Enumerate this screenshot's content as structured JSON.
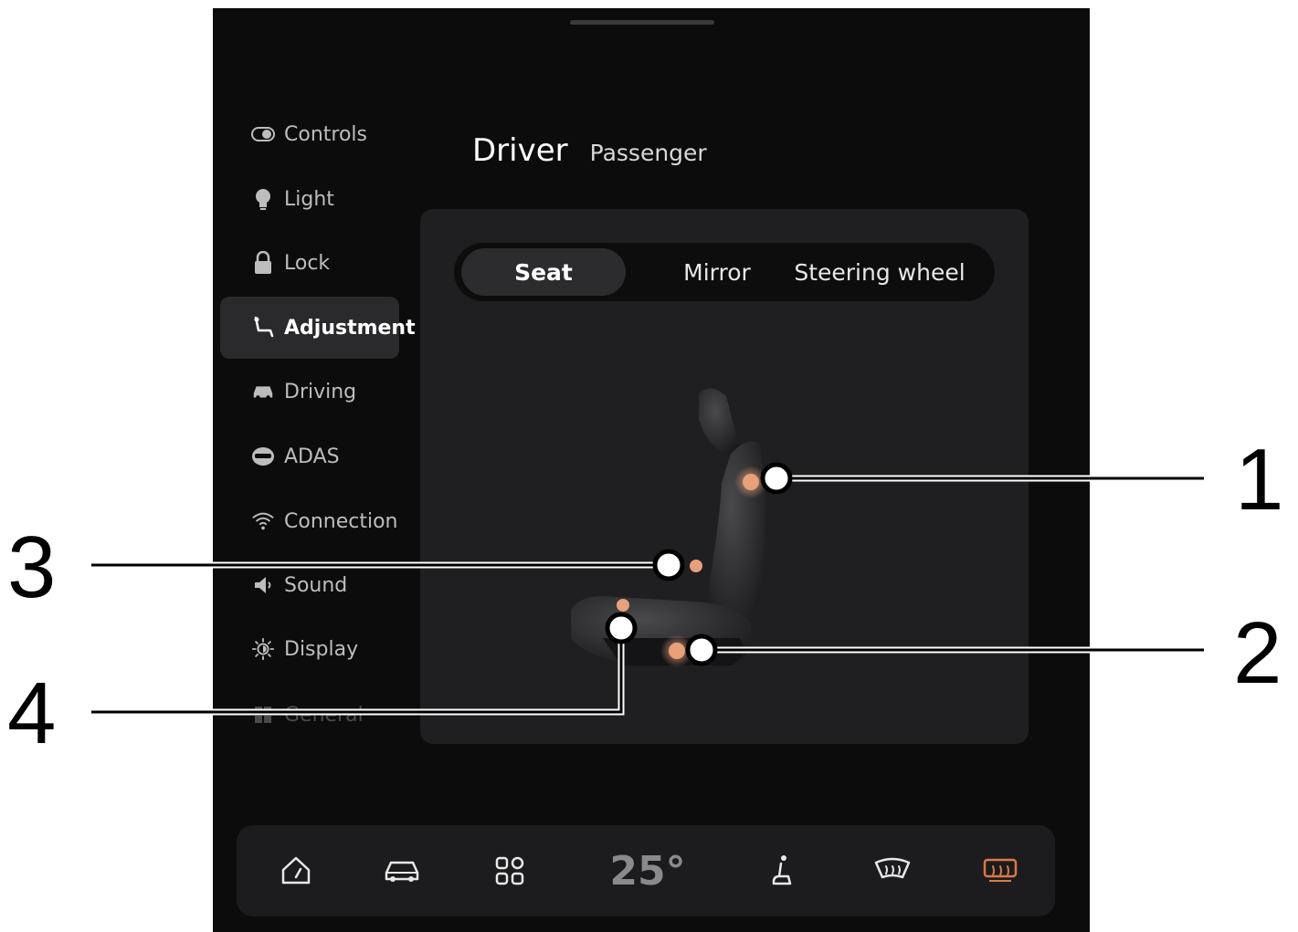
{
  "sidebar": {
    "items": [
      {
        "label": "Controls",
        "icon": "toggle-icon"
      },
      {
        "label": "Light",
        "icon": "bulb-icon"
      },
      {
        "label": "Lock",
        "icon": "lock-icon"
      },
      {
        "label": "Adjustment",
        "icon": "seat-icon"
      },
      {
        "label": "Driving",
        "icon": "car-icon"
      },
      {
        "label": "ADAS",
        "icon": "adas-icon"
      },
      {
        "label": "Connection",
        "icon": "wifi-icon"
      },
      {
        "label": "Sound",
        "icon": "speaker-icon"
      },
      {
        "label": "Display",
        "icon": "brightness-icon"
      },
      {
        "label": "General",
        "icon": "grid-icon"
      }
    ],
    "active": "Adjustment"
  },
  "header": {
    "driver_label": "Driver",
    "passenger_label": "Passenger"
  },
  "tabs": {
    "seat": "Seat",
    "mirror": "Mirror",
    "steering": "Steering wheel",
    "active": "Seat"
  },
  "bottom_bar": {
    "temperature": "25°",
    "icons": [
      "dashboard-icon",
      "car-icon",
      "apps-icon",
      "seat-icon",
      "front-defrost-icon",
      "rear-defrost-icon"
    ]
  },
  "callouts": {
    "one": "1",
    "two": "2",
    "three": "3",
    "four": "4"
  },
  "colors": {
    "accent": "#e8a07a",
    "rear_defrost_active": "#d9794a",
    "background": "#0c0c0d",
    "panel": "#1f1f21"
  }
}
